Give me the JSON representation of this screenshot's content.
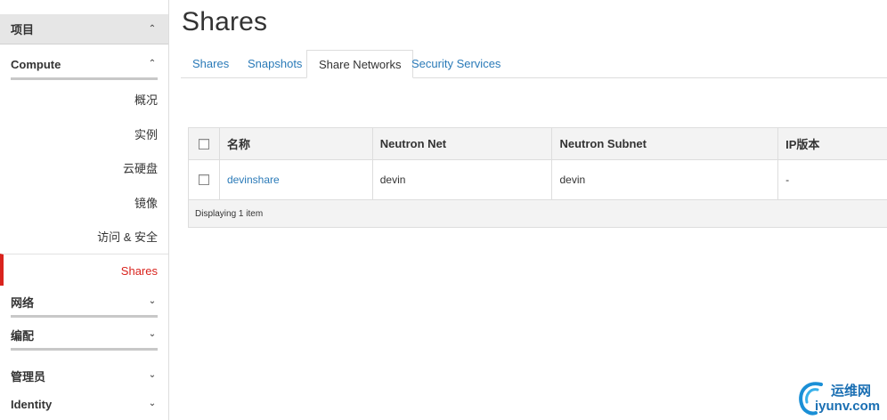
{
  "sidebar": {
    "project": {
      "label": "项目",
      "icon": "chevron-up-icon"
    },
    "compute": {
      "label": "Compute",
      "icon": "chevron-up-icon"
    },
    "compute_items": [
      {
        "label": "概况"
      },
      {
        "label": "实例"
      },
      {
        "label": "云硬盘"
      },
      {
        "label": "镜像"
      },
      {
        "label": "访问 & 安全"
      },
      {
        "label": "Shares",
        "active": true
      }
    ],
    "network": {
      "label": "网络",
      "icon": "chevron-down-icon"
    },
    "orchestration": {
      "label": "编配",
      "icon": "chevron-down-icon"
    },
    "admin": {
      "label": "管理员",
      "icon": "chevron-down-icon"
    },
    "identity": {
      "label": "Identity",
      "icon": "chevron-down-icon"
    }
  },
  "page": {
    "title": "Shares"
  },
  "tabs": [
    {
      "label": "Shares"
    },
    {
      "label": "Snapshots"
    },
    {
      "label": "Share Networks",
      "active": true
    },
    {
      "label": "Security Services"
    }
  ],
  "table": {
    "columns": [
      "名称",
      "Neutron Net",
      "Neutron Subnet",
      "IP版本"
    ],
    "rows": [
      {
        "name": "devinshare",
        "neutron_net": "devin",
        "neutron_subnet": "devin",
        "ip_version": "-"
      }
    ],
    "footer": "Displaying 1 item"
  },
  "watermark": {
    "cn": "运维网",
    "en": "iyunv.com"
  },
  "colors": {
    "accent_red": "#d9231d",
    "link_blue": "#2a7ab8"
  }
}
